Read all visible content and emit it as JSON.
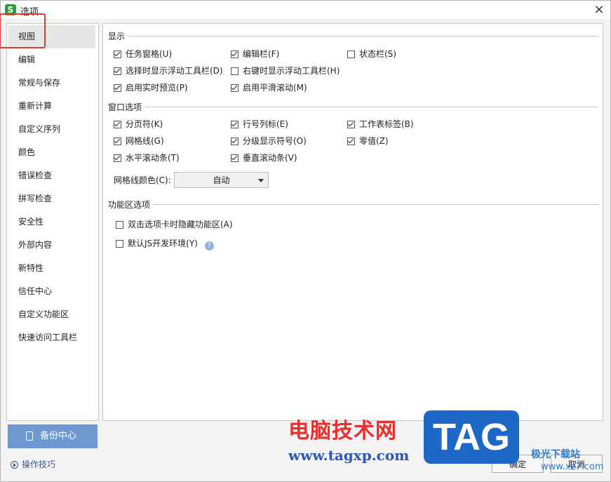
{
  "window": {
    "title": "选项",
    "app_icon": "S",
    "close": "×"
  },
  "sidebar": {
    "items": [
      {
        "label": "视图",
        "active": true
      },
      {
        "label": "编辑"
      },
      {
        "label": "常规与保存"
      },
      {
        "label": "重新计算"
      },
      {
        "label": "自定义序列"
      },
      {
        "label": "颜色"
      },
      {
        "label": "错误检查"
      },
      {
        "label": "拼写检查"
      },
      {
        "label": "安全性"
      },
      {
        "label": "外部内容"
      },
      {
        "label": "新特性"
      },
      {
        "label": "信任中心"
      },
      {
        "label": "自定义功能区"
      },
      {
        "label": "快速访问工具栏"
      }
    ]
  },
  "display": {
    "title": "显示",
    "options": [
      {
        "label": "任务窗格(U)",
        "checked": true
      },
      {
        "label": "编辑栏(F)",
        "checked": true
      },
      {
        "label": "状态栏(S)",
        "checked": false
      },
      {
        "label": "选择时显示浮动工具栏(D)",
        "checked": true
      },
      {
        "label": "右键时显示浮动工具栏(H)",
        "checked": false
      },
      {
        "label": "启用实时预览(P)",
        "checked": true
      },
      {
        "label": "启用平滑滚动(M)",
        "checked": true
      }
    ]
  },
  "window_options": {
    "title": "窗口选项",
    "options": [
      {
        "label": "分页符(K)",
        "checked": true
      },
      {
        "label": "行号列标(E)",
        "checked": true
      },
      {
        "label": "工作表标签(B)",
        "checked": true
      },
      {
        "label": "网格线(G)",
        "checked": true
      },
      {
        "label": "分级显示符号(O)",
        "checked": true
      },
      {
        "label": "零值(Z)",
        "checked": true
      },
      {
        "label": "水平滚动条(T)",
        "checked": true
      },
      {
        "label": "垂直滚动条(V)",
        "checked": true
      }
    ],
    "gridline_color_label": "网格线颜色(C):",
    "gridline_color_value": "自动"
  },
  "ribbon": {
    "title": "功能区选项",
    "options": [
      {
        "label": "双击选项卡时隐藏功能区(A)",
        "checked": false
      },
      {
        "label": "默认JS开发环境(Y)",
        "checked": false
      }
    ],
    "help": "?"
  },
  "footer": {
    "backup_label": "备份中心",
    "tips_label": "操作技巧",
    "ok_label": "确定",
    "cancel_label": "取消"
  },
  "watermark": {
    "text_cn": "电脑技术网",
    "url": "www.tagxp.com",
    "tag": "TAG",
    "site_cn": "极光下载站",
    "site_url": "www.xz7.com"
  },
  "colors": {
    "accent": "#6f97d2",
    "highlight": "#e53935",
    "check": "#222222"
  }
}
